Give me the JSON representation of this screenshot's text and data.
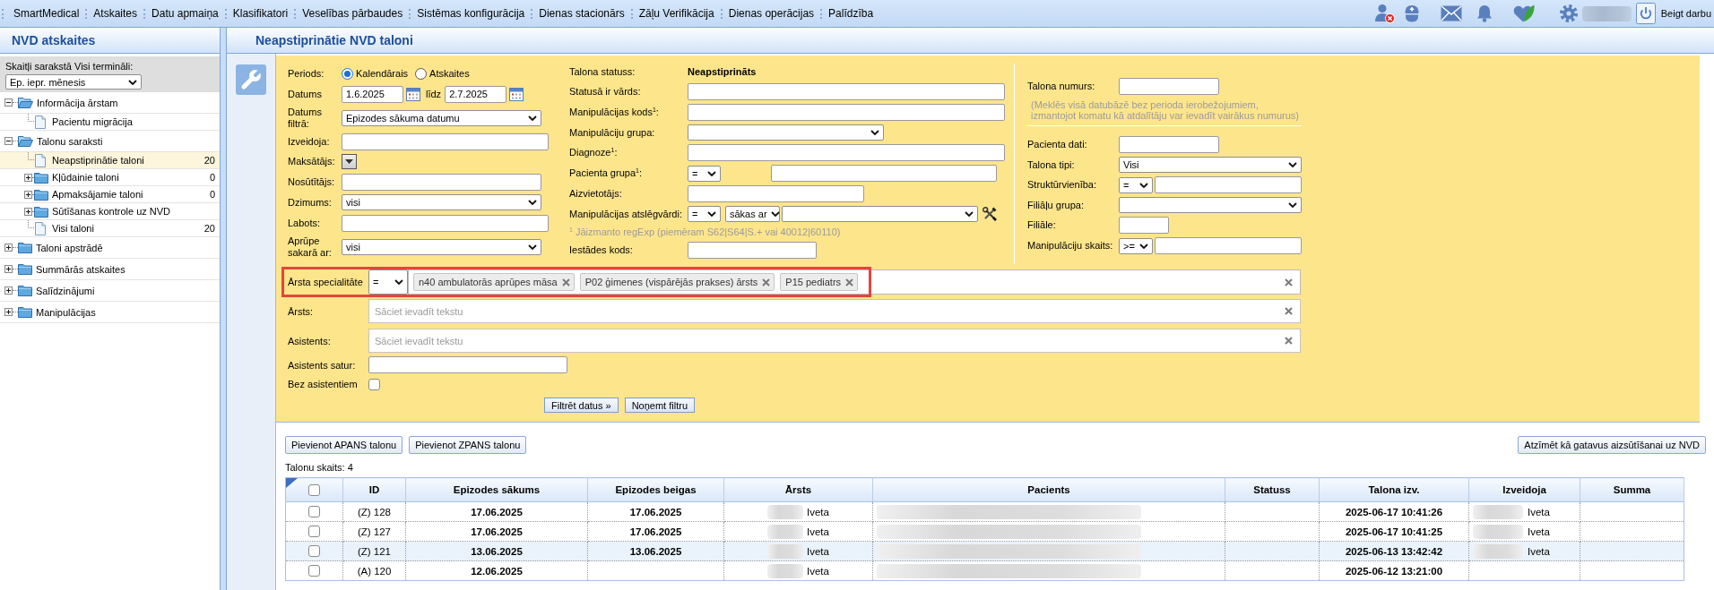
{
  "menu": {
    "items": [
      "SmartMedical",
      "Atskaites",
      "Datu apmaiņa",
      "Klasifikatori",
      "Veselības pārbaudes",
      "Sistēmas konfigurācija",
      "Dienas stacionārs",
      "Zāļu Verifikācija",
      "Dienas operācijas",
      "Palīdzība"
    ],
    "user_name_blurred": true,
    "logout": "Beigt darbu"
  },
  "sidebar": {
    "title": "NVD atskaites",
    "terminal_label": "Skaitļi sarakstā Visi termināli:",
    "period": "Ep. iepr. mēnesis",
    "tree": [
      {
        "kind": "folder",
        "label": "Informācija ārstam",
        "expanded": true,
        "selected": false,
        "children": [
          {
            "kind": "page",
            "label": "Pacientu migrācija",
            "selected": false
          }
        ]
      },
      {
        "kind": "folder",
        "label": "Talonu saraksti",
        "expanded": true,
        "selected": false,
        "children": [
          {
            "kind": "page",
            "label": "Neapstiprinātie taloni",
            "count": "20",
            "selected": true
          },
          {
            "kind": "folder",
            "label": "Kļūdainie taloni",
            "count": "0",
            "expanded": false,
            "selected": false
          },
          {
            "kind": "folder",
            "label": "Apmaksājamie taloni",
            "count": "0",
            "expanded": false,
            "selected": false
          },
          {
            "kind": "folder",
            "label": "Sūtīšanas kontrole uz NVD",
            "expanded": false,
            "selected": false
          },
          {
            "kind": "page",
            "label": "Visi taloni",
            "count": "20",
            "selected": false
          }
        ]
      },
      {
        "kind": "folder",
        "label": "Taloni apstrādē",
        "expanded": false,
        "selected": false
      },
      {
        "kind": "folder",
        "label": "Summārās atskaites",
        "expanded": false,
        "selected": false
      },
      {
        "kind": "folder",
        "label": "Salīdzinājumi",
        "expanded": false,
        "selected": false
      },
      {
        "kind": "folder",
        "label": "Manipulācijas",
        "expanded": false,
        "selected": false
      }
    ]
  },
  "page": {
    "title": "Neapstiprinātie NVD taloni"
  },
  "filter": {
    "left_fields": [
      {
        "kind": "radio",
        "label": "Periods:",
        "options": [
          {
            "label": "Kalendārais",
            "selected": true
          },
          {
            "label": "Atskaites",
            "selected": false
          }
        ]
      },
      {
        "kind": "date-range",
        "label": "Datums",
        "from": "1.6.2025",
        "between": "līdz",
        "to": "2.7.2025"
      },
      {
        "kind": "select",
        "label": "Datums filtrā:",
        "value": "Epizodes sākuma datumu"
      },
      {
        "kind": "text",
        "label": "Izveidoja:"
      },
      {
        "kind": "dropdown-button",
        "label": "Maksātājs:"
      },
      {
        "kind": "text",
        "label": "Nosūtītājs:"
      },
      {
        "kind": "select",
        "label": "Dzimums:",
        "value": "visi"
      },
      {
        "kind": "text",
        "label": "Labots:"
      },
      {
        "kind": "select",
        "label": "Aprūpe sakarā ar:",
        "value": "visi"
      }
    ],
    "middle_fields": [
      {
        "kind": "status",
        "label": "Talona statuss:",
        "value": "Neapstiprināts"
      },
      {
        "kind": "text",
        "label": "Statusā ir vārds:"
      },
      {
        "kind": "text",
        "label": "Manipulācijas kods$^{1}$:"
      },
      {
        "kind": "select",
        "label": "Manipulāciju grupa:"
      },
      {
        "kind": "text",
        "label": "Diagnoze$^{1}$:"
      },
      {
        "kind": "operator-text",
        "label": "Pacienta grupa$^{1}$:",
        "operator": "="
      },
      {
        "kind": "text",
        "label": "Aizvietotājs:"
      },
      {
        "kind": "keywords",
        "label": "Manipulācijas atslēgvārdi:",
        "operator": "=",
        "match": "sākas ar"
      },
      {
        "kind": "note",
        "text": "$^{1}$ Jāizmanto regExp (piemēram S62|S64|S.+ vai 40012|60110)"
      },
      {
        "kind": "text",
        "label": "Iestādes kods:"
      }
    ],
    "right_fields": [
      {
        "kind": "text",
        "label": "Talona numurs:"
      },
      {
        "kind": "hint",
        "text": "(Meklēs visā datubāzē bez perioda ierobežojumiem,\nizmantojot komatu kā atdalītāju var ievadīt vairākus numurus)"
      },
      {
        "kind": "text",
        "label": "Pacienta dati:"
      },
      {
        "kind": "select",
        "label": "Talona tipi:",
        "value": "Visi"
      },
      {
        "kind": "operator-text",
        "label": "Struktūrvienība:",
        "operator": "="
      },
      {
        "kind": "select",
        "label": "Filiāļu grupa:"
      },
      {
        "kind": "text",
        "label": "Filiāle:"
      },
      {
        "kind": "operator-text",
        "label": "Manipulāciju skaits:",
        "operator": ">="
      }
    ],
    "specialty": {
      "label": "Ārsta specialitāte",
      "operator": "=",
      "tags": [
        "n40 ambulatorās aprūpes māsa",
        "P02 ģimenes (vispārējās prakses) ārsts",
        "P15 pediatrs"
      ],
      "highlighted": true
    },
    "doctor": {
      "label": "Ārsts:",
      "placeholder": "Sāciet ievadīt tekstu"
    },
    "assistant": {
      "label": "Asistents:",
      "placeholder": "Sāciet ievadīt tekstu"
    },
    "assistant_contains": {
      "label": "Asistents satur:"
    },
    "no_assistants": {
      "label": "Bez asistentiem",
      "checked": false
    },
    "buttons": [
      "Filtrēt datus »",
      "Noņemt filtru"
    ]
  },
  "actions": {
    "buttons": [
      "Pievienot APANS talonu",
      "Pievienot ZPANS talonu"
    ],
    "mark_ready": "Atzīmēt kā gatavus aizsūtīšanai uz NVD",
    "count": "Talonu skaits: 4"
  },
  "table": {
    "select_all_checked": false,
    "columns": [
      "ID",
      "Epizodes sākums",
      "Epizodes beigas",
      "Ārsts",
      "Pacients",
      "Statuss",
      "Talona izv.",
      "Izveidoja",
      "Summa"
    ],
    "rows": [
      {
        "checked": false,
        "selected": false,
        "id": "(Z) 128",
        "start": "17.06.2025",
        "end": "17.06.2025",
        "doctor": "Iveta",
        "doctor_blurred": true,
        "patient_blurred": true,
        "created": "2025-06-17 10:41:26",
        "creator": "Iveta",
        "creator_blurred": true
      },
      {
        "checked": false,
        "selected": false,
        "id": "(Z) 127",
        "start": "17.06.2025",
        "end": "17.06.2025",
        "doctor": "Iveta",
        "doctor_blurred": true,
        "patient_blurred": true,
        "created": "2025-06-17 10:41:25",
        "creator": "Iveta",
        "creator_blurred": true
      },
      {
        "checked": false,
        "selected": true,
        "id": "(Z) 121",
        "start": "13.06.2025",
        "end": "13.06.2025",
        "doctor": "Iveta",
        "doctor_blurred": true,
        "patient_blurred": true,
        "created": "2025-06-13 13:42:42",
        "creator": "Iveta",
        "creator_blurred": true
      },
      {
        "checked": false,
        "selected": false,
        "id": "(A) 120",
        "start": "12.06.2025",
        "doctor": "Iveta",
        "doctor_blurred": true,
        "patient_blurred": true,
        "created": "2025-06-12 13:21:00",
        "creator_blurred": false
      }
    ]
  }
}
